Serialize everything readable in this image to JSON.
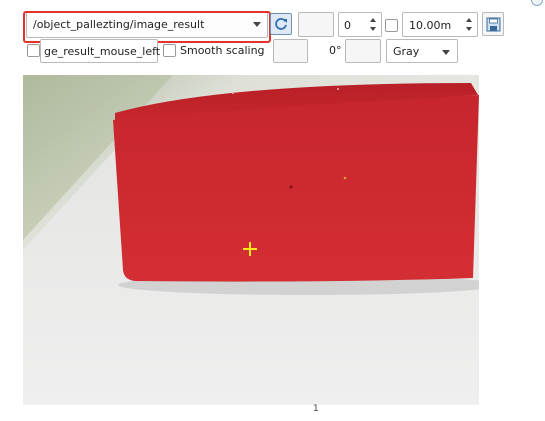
{
  "toolbar": {
    "topic": "/object_pallezting/image_result",
    "zero_value": "0",
    "scale_value": "10.00m",
    "mouse_topic": "ge_result_mouse_left",
    "smooth_label": "Smooth scaling",
    "rotation": "0°",
    "colormap": "Gray"
  },
  "icons": {
    "refresh": "refresh-icon",
    "save": "save-image-icon",
    "dropdown": "chevron-down-icon",
    "crosshair": "crosshair-marker"
  },
  "colors": {
    "highlight": "#e4332a",
    "crosshair": "#ffe81a",
    "object": "#c9262c"
  },
  "footer": {
    "mark": "1"
  }
}
